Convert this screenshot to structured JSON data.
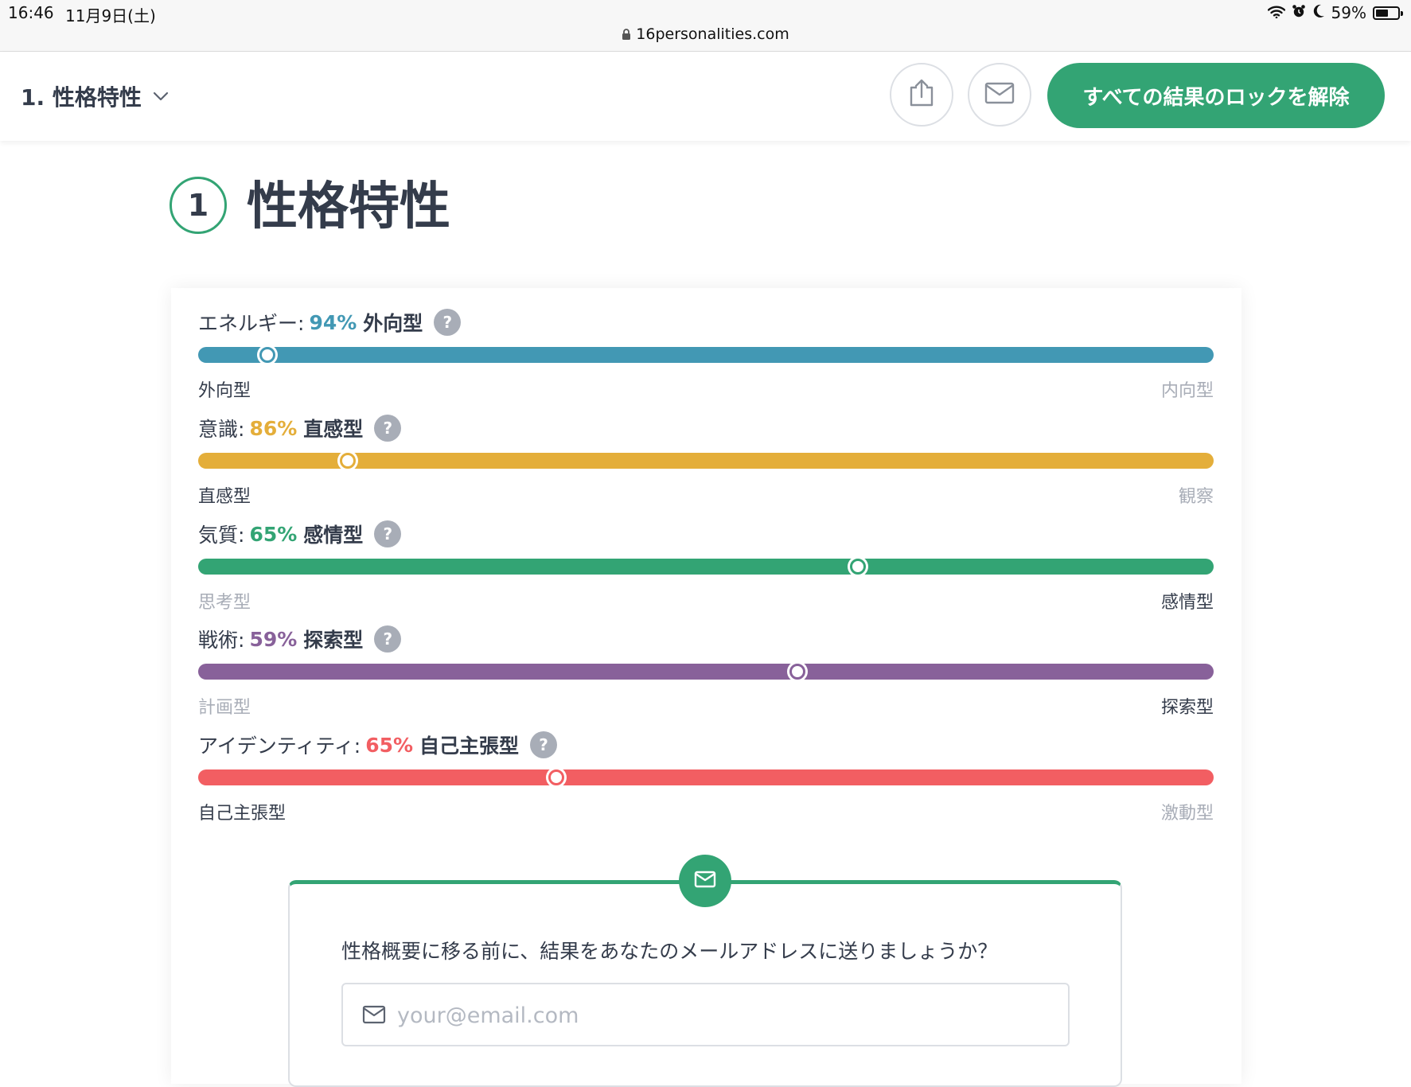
{
  "status_bar": {
    "time": "16:46",
    "date": "11月9日(土)",
    "url": "16personalities.com",
    "battery": "59%",
    "battery_level": 0.59
  },
  "header": {
    "section_select_label": "1. 性格特性",
    "unlock_button": "すべての結果のロックを解除",
    "accent_color": "#33a474"
  },
  "section": {
    "number": "1",
    "title": "性格特性"
  },
  "traits": [
    {
      "name": "エネルギー:",
      "percent": "94%",
      "type": "外向型",
      "position": 0.068,
      "color": "#4298b4",
      "left_pole": "外向型",
      "right_pole": "内向型",
      "active_side": "left"
    },
    {
      "name": "意識:",
      "percent": "86%",
      "type": "直感型",
      "position": 0.147,
      "color": "#e4ae3a",
      "left_pole": "直感型",
      "right_pole": "観察",
      "active_side": "left"
    },
    {
      "name": "気質:",
      "percent": "65%",
      "type": "感情型",
      "position": 0.65,
      "color": "#33a474",
      "left_pole": "思考型",
      "right_pole": "感情型",
      "active_side": "right"
    },
    {
      "name": "戦術:",
      "percent": "59%",
      "type": "探索型",
      "position": 0.59,
      "color": "#88619a",
      "left_pole": "計画型",
      "right_pole": "探索型",
      "active_side": "right"
    },
    {
      "name": "アイデンティティ:",
      "percent": "65%",
      "type": "自己主張型",
      "position": 0.353,
      "color": "#f25e62",
      "left_pole": "自己主張型",
      "right_pole": "激動型",
      "active_side": "left"
    }
  ],
  "help_glyph": "?",
  "email": {
    "prompt": "性格概要に移る前に、結果をあなたのメールアドレスに送りましょうか？",
    "placeholder": "your@email.com",
    "value": ""
  }
}
